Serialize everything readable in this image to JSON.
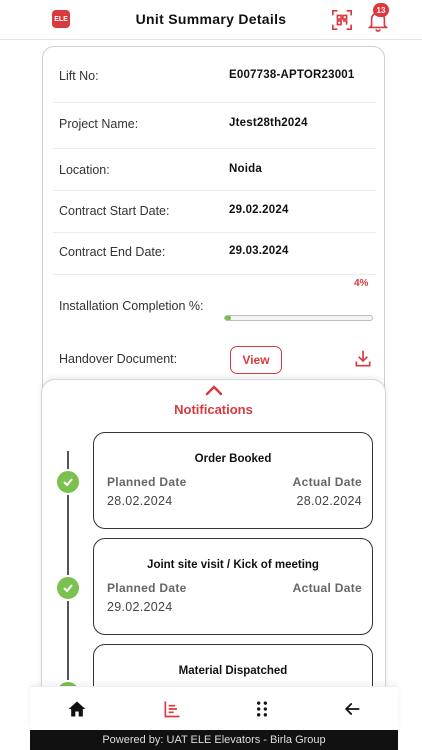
{
  "header": {
    "logo_text": "ELE",
    "title": "Unit Summary Details",
    "notification_count": "13"
  },
  "details": {
    "rows": [
      {
        "label": "Lift No:",
        "value": "E007738-APTOR23001"
      },
      {
        "label": "Project Name:",
        "value": "Jtest28th2024"
      },
      {
        "label": "Location:",
        "value": "Noida"
      },
      {
        "label": "Contract Start Date:",
        "value": "29.02.2024"
      },
      {
        "label": "Contract End Date:",
        "value": "29.03.2024"
      }
    ],
    "installation": {
      "label": "Installation Completion %:",
      "percent_text": "4%",
      "percent": 4
    },
    "handover": {
      "label": "Handover Document:",
      "button": "View"
    }
  },
  "notifications": {
    "title": "Notifications",
    "items": [
      {
        "title": "Order Booked",
        "planned_label": "Planned Date",
        "actual_label": "Actual Date",
        "planned": "28.02.2024",
        "actual": "28.02.2024"
      },
      {
        "title": "Joint site visit / Kick of meeting",
        "planned_label": "Planned Date",
        "actual_label": "Actual Date",
        "planned": "29.02.2024",
        "actual": ""
      },
      {
        "title": "Material Dispatched",
        "planned_label": "",
        "actual_label": "",
        "planned": "",
        "actual": ""
      }
    ]
  },
  "footer": {
    "text": "Powered by: UAT ELE Elevators - Birla Group"
  },
  "colors": {
    "accent": "#d83a3f",
    "success": "#7cc04f"
  }
}
